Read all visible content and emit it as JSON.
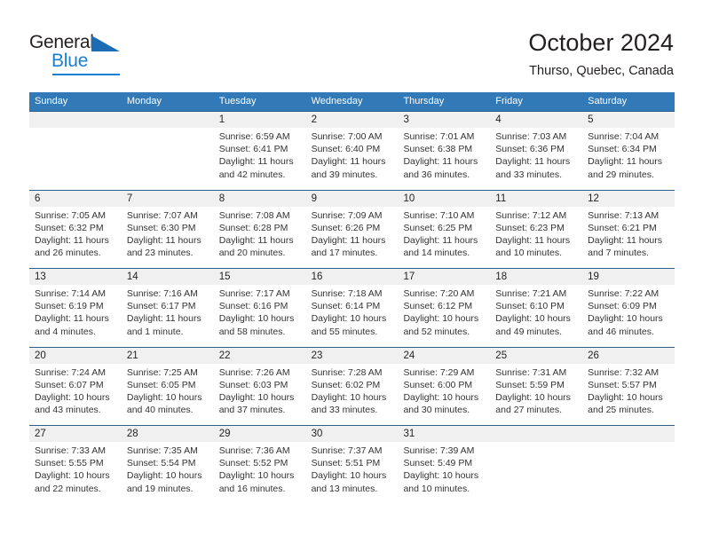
{
  "brand": {
    "name_top": "General",
    "name_bottom": "Blue",
    "triangle_color": "#1b6cb5",
    "blue_color": "#1b7fd4"
  },
  "header": {
    "title": "October 2024",
    "location": "Thurso, Quebec, Canada"
  },
  "theme": {
    "header_bar": "#3279b7",
    "week_divider": "#2c5f8e",
    "day_number_band": "#f0f0f0",
    "text": "#231f20"
  },
  "weekday_headers": [
    "Sunday",
    "Monday",
    "Tuesday",
    "Wednesday",
    "Thursday",
    "Friday",
    "Saturday"
  ],
  "weeks": [
    [
      {
        "day": "",
        "sunrise": "",
        "sunset": "",
        "daylight_line1": "",
        "daylight_line2": ""
      },
      {
        "day": "",
        "sunrise": "",
        "sunset": "",
        "daylight_line1": "",
        "daylight_line2": ""
      },
      {
        "day": "1",
        "sunrise": "Sunrise: 6:59 AM",
        "sunset": "Sunset: 6:41 PM",
        "daylight_line1": "Daylight: 11 hours",
        "daylight_line2": "and 42 minutes."
      },
      {
        "day": "2",
        "sunrise": "Sunrise: 7:00 AM",
        "sunset": "Sunset: 6:40 PM",
        "daylight_line1": "Daylight: 11 hours",
        "daylight_line2": "and 39 minutes."
      },
      {
        "day": "3",
        "sunrise": "Sunrise: 7:01 AM",
        "sunset": "Sunset: 6:38 PM",
        "daylight_line1": "Daylight: 11 hours",
        "daylight_line2": "and 36 minutes."
      },
      {
        "day": "4",
        "sunrise": "Sunrise: 7:03 AM",
        "sunset": "Sunset: 6:36 PM",
        "daylight_line1": "Daylight: 11 hours",
        "daylight_line2": "and 33 minutes."
      },
      {
        "day": "5",
        "sunrise": "Sunrise: 7:04 AM",
        "sunset": "Sunset: 6:34 PM",
        "daylight_line1": "Daylight: 11 hours",
        "daylight_line2": "and 29 minutes."
      }
    ],
    [
      {
        "day": "6",
        "sunrise": "Sunrise: 7:05 AM",
        "sunset": "Sunset: 6:32 PM",
        "daylight_line1": "Daylight: 11 hours",
        "daylight_line2": "and 26 minutes."
      },
      {
        "day": "7",
        "sunrise": "Sunrise: 7:07 AM",
        "sunset": "Sunset: 6:30 PM",
        "daylight_line1": "Daylight: 11 hours",
        "daylight_line2": "and 23 minutes."
      },
      {
        "day": "8",
        "sunrise": "Sunrise: 7:08 AM",
        "sunset": "Sunset: 6:28 PM",
        "daylight_line1": "Daylight: 11 hours",
        "daylight_line2": "and 20 minutes."
      },
      {
        "day": "9",
        "sunrise": "Sunrise: 7:09 AM",
        "sunset": "Sunset: 6:26 PM",
        "daylight_line1": "Daylight: 11 hours",
        "daylight_line2": "and 17 minutes."
      },
      {
        "day": "10",
        "sunrise": "Sunrise: 7:10 AM",
        "sunset": "Sunset: 6:25 PM",
        "daylight_line1": "Daylight: 11 hours",
        "daylight_line2": "and 14 minutes."
      },
      {
        "day": "11",
        "sunrise": "Sunrise: 7:12 AM",
        "sunset": "Sunset: 6:23 PM",
        "daylight_line1": "Daylight: 11 hours",
        "daylight_line2": "and 10 minutes."
      },
      {
        "day": "12",
        "sunrise": "Sunrise: 7:13 AM",
        "sunset": "Sunset: 6:21 PM",
        "daylight_line1": "Daylight: 11 hours",
        "daylight_line2": "and 7 minutes."
      }
    ],
    [
      {
        "day": "13",
        "sunrise": "Sunrise: 7:14 AM",
        "sunset": "Sunset: 6:19 PM",
        "daylight_line1": "Daylight: 11 hours",
        "daylight_line2": "and 4 minutes."
      },
      {
        "day": "14",
        "sunrise": "Sunrise: 7:16 AM",
        "sunset": "Sunset: 6:17 PM",
        "daylight_line1": "Daylight: 11 hours",
        "daylight_line2": "and 1 minute."
      },
      {
        "day": "15",
        "sunrise": "Sunrise: 7:17 AM",
        "sunset": "Sunset: 6:16 PM",
        "daylight_line1": "Daylight: 10 hours",
        "daylight_line2": "and 58 minutes."
      },
      {
        "day": "16",
        "sunrise": "Sunrise: 7:18 AM",
        "sunset": "Sunset: 6:14 PM",
        "daylight_line1": "Daylight: 10 hours",
        "daylight_line2": "and 55 minutes."
      },
      {
        "day": "17",
        "sunrise": "Sunrise: 7:20 AM",
        "sunset": "Sunset: 6:12 PM",
        "daylight_line1": "Daylight: 10 hours",
        "daylight_line2": "and 52 minutes."
      },
      {
        "day": "18",
        "sunrise": "Sunrise: 7:21 AM",
        "sunset": "Sunset: 6:10 PM",
        "daylight_line1": "Daylight: 10 hours",
        "daylight_line2": "and 49 minutes."
      },
      {
        "day": "19",
        "sunrise": "Sunrise: 7:22 AM",
        "sunset": "Sunset: 6:09 PM",
        "daylight_line1": "Daylight: 10 hours",
        "daylight_line2": "and 46 minutes."
      }
    ],
    [
      {
        "day": "20",
        "sunrise": "Sunrise: 7:24 AM",
        "sunset": "Sunset: 6:07 PM",
        "daylight_line1": "Daylight: 10 hours",
        "daylight_line2": "and 43 minutes."
      },
      {
        "day": "21",
        "sunrise": "Sunrise: 7:25 AM",
        "sunset": "Sunset: 6:05 PM",
        "daylight_line1": "Daylight: 10 hours",
        "daylight_line2": "and 40 minutes."
      },
      {
        "day": "22",
        "sunrise": "Sunrise: 7:26 AM",
        "sunset": "Sunset: 6:03 PM",
        "daylight_line1": "Daylight: 10 hours",
        "daylight_line2": "and 37 minutes."
      },
      {
        "day": "23",
        "sunrise": "Sunrise: 7:28 AM",
        "sunset": "Sunset: 6:02 PM",
        "daylight_line1": "Daylight: 10 hours",
        "daylight_line2": "and 33 minutes."
      },
      {
        "day": "24",
        "sunrise": "Sunrise: 7:29 AM",
        "sunset": "Sunset: 6:00 PM",
        "daylight_line1": "Daylight: 10 hours",
        "daylight_line2": "and 30 minutes."
      },
      {
        "day": "25",
        "sunrise": "Sunrise: 7:31 AM",
        "sunset": "Sunset: 5:59 PM",
        "daylight_line1": "Daylight: 10 hours",
        "daylight_line2": "and 27 minutes."
      },
      {
        "day": "26",
        "sunrise": "Sunrise: 7:32 AM",
        "sunset": "Sunset: 5:57 PM",
        "daylight_line1": "Daylight: 10 hours",
        "daylight_line2": "and 25 minutes."
      }
    ],
    [
      {
        "day": "27",
        "sunrise": "Sunrise: 7:33 AM",
        "sunset": "Sunset: 5:55 PM",
        "daylight_line1": "Daylight: 10 hours",
        "daylight_line2": "and 22 minutes."
      },
      {
        "day": "28",
        "sunrise": "Sunrise: 7:35 AM",
        "sunset": "Sunset: 5:54 PM",
        "daylight_line1": "Daylight: 10 hours",
        "daylight_line2": "and 19 minutes."
      },
      {
        "day": "29",
        "sunrise": "Sunrise: 7:36 AM",
        "sunset": "Sunset: 5:52 PM",
        "daylight_line1": "Daylight: 10 hours",
        "daylight_line2": "and 16 minutes."
      },
      {
        "day": "30",
        "sunrise": "Sunrise: 7:37 AM",
        "sunset": "Sunset: 5:51 PM",
        "daylight_line1": "Daylight: 10 hours",
        "daylight_line2": "and 13 minutes."
      },
      {
        "day": "31",
        "sunrise": "Sunrise: 7:39 AM",
        "sunset": "Sunset: 5:49 PM",
        "daylight_line1": "Daylight: 10 hours",
        "daylight_line2": "and 10 minutes."
      },
      {
        "day": "",
        "sunrise": "",
        "sunset": "",
        "daylight_line1": "",
        "daylight_line2": ""
      },
      {
        "day": "",
        "sunrise": "",
        "sunset": "",
        "daylight_line1": "",
        "daylight_line2": ""
      }
    ]
  ]
}
